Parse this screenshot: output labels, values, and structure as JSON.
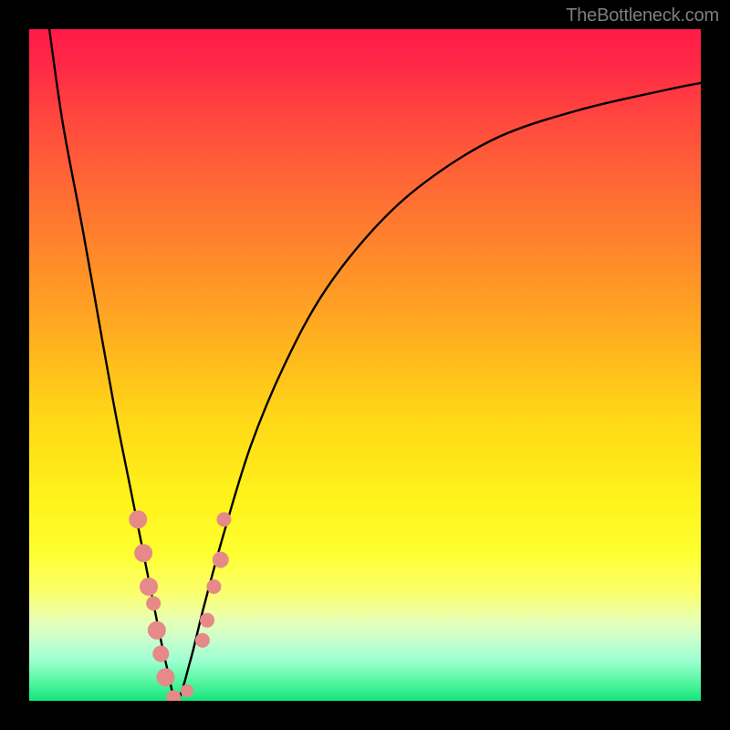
{
  "watermark": "TheBottleneck.com",
  "chart_data": {
    "type": "line",
    "title": "",
    "xlabel": "",
    "ylabel": "",
    "xlim": [
      0,
      100
    ],
    "ylim": [
      0,
      100
    ],
    "series": [
      {
        "name": "bottleneck-curve",
        "x": [
          3,
          5,
          8,
          11,
          13,
          15,
          17,
          19,
          20.5,
          22,
          24,
          26,
          29,
          33,
          38,
          44,
          52,
          60,
          70,
          82,
          95,
          100
        ],
        "y": [
          100,
          86,
          70,
          53,
          42,
          32,
          22,
          12,
          5,
          0,
          6,
          14,
          25,
          38,
          50,
          61,
          71,
          78,
          84,
          88,
          91,
          92
        ]
      }
    ],
    "markers": {
      "name": "highlight-points",
      "color": "#e58a88",
      "points": [
        {
          "x": 16.2,
          "y": 27,
          "r": 10
        },
        {
          "x": 17.0,
          "y": 22,
          "r": 10
        },
        {
          "x": 17.8,
          "y": 17,
          "r": 10
        },
        {
          "x": 18.5,
          "y": 14.5,
          "r": 8
        },
        {
          "x": 19.0,
          "y": 10.5,
          "r": 10
        },
        {
          "x": 19.6,
          "y": 7,
          "r": 9
        },
        {
          "x": 20.3,
          "y": 3.5,
          "r": 10
        },
        {
          "x": 21.5,
          "y": 0.5,
          "r": 8
        },
        {
          "x": 23.5,
          "y": 1.5,
          "r": 7
        },
        {
          "x": 25.8,
          "y": 9,
          "r": 8
        },
        {
          "x": 26.5,
          "y": 12,
          "r": 8
        },
        {
          "x": 27.5,
          "y": 17,
          "r": 8
        },
        {
          "x": 28.5,
          "y": 21,
          "r": 9
        },
        {
          "x": 29.0,
          "y": 27,
          "r": 8
        }
      ]
    },
    "gradient_stops": [
      {
        "pos": 0.0,
        "color": "#ff1a49"
      },
      {
        "pos": 0.3,
        "color": "#ff7a2e"
      },
      {
        "pos": 0.6,
        "color": "#ffe61a"
      },
      {
        "pos": 0.85,
        "color": "#f3ff7a"
      },
      {
        "pos": 1.0,
        "color": "#14e57c"
      }
    ]
  }
}
